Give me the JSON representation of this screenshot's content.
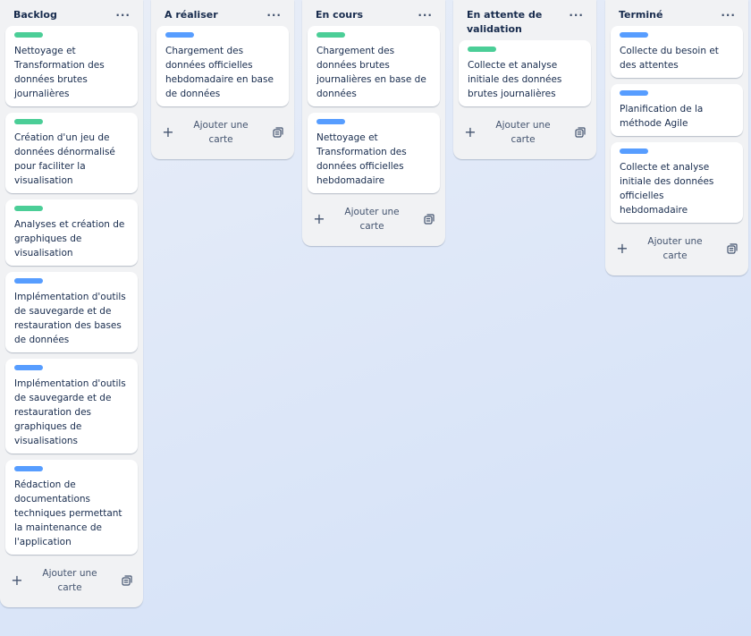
{
  "colors": {
    "label_green": "#4bce97",
    "label_blue": "#579dff",
    "list_bg": "#f1f2f4"
  },
  "icons": {
    "menu": "ellipsis-icon",
    "add": "plus-icon",
    "template": "card-template-icon"
  },
  "lists": [
    {
      "title": "Backlog",
      "menu_label": "···",
      "add_label": "Ajouter une carte",
      "cards": [
        {
          "label_color": "green",
          "text": "Nettoyage et Transformation des données brutes journalières"
        },
        {
          "label_color": "green",
          "text": "Création d'un jeu de données dénormalisé pour faciliter la visualisation"
        },
        {
          "label_color": "green",
          "text": "Analyses et création de graphiques de visualisation"
        },
        {
          "label_color": "blue",
          "text": "Implémentation d'outils de sauvegarde et de restauration des bases de données"
        },
        {
          "label_color": "blue",
          "text": "Implémentation d'outils de sauvegarde et de restauration des graphiques de visualisations"
        },
        {
          "label_color": "blue",
          "text": "Rédaction de documentations techniques permettant la maintenance de l'application"
        }
      ]
    },
    {
      "title": "A réaliser",
      "menu_label": "···",
      "add_label": "Ajouter une carte",
      "cards": [
        {
          "label_color": "blue",
          "text": "Chargement des données officielles hebdomadaire en base de données"
        }
      ]
    },
    {
      "title": "En cours",
      "menu_label": "···",
      "add_label": "Ajouter une carte",
      "cards": [
        {
          "label_color": "green",
          "text": "Chargement des données brutes journalières en base de données"
        },
        {
          "label_color": "blue",
          "text": "Nettoyage et Transformation des données officielles hebdomadaire"
        }
      ]
    },
    {
      "title": "En attente de validation",
      "menu_label": "···",
      "add_label": "Ajouter une carte",
      "cards": [
        {
          "label_color": "green",
          "text": "Collecte et analyse initiale des données brutes journalières"
        }
      ]
    },
    {
      "title": "Terminé",
      "menu_label": "···",
      "add_label": "Ajouter une carte",
      "cards": [
        {
          "label_color": "blue",
          "text": "Collecte du besoin et des attentes"
        },
        {
          "label_color": "blue",
          "text": "Planification de la méthode Agile"
        },
        {
          "label_color": "blue",
          "text": "Collecte et analyse initiale des données officielles hebdomadaire"
        }
      ]
    }
  ]
}
